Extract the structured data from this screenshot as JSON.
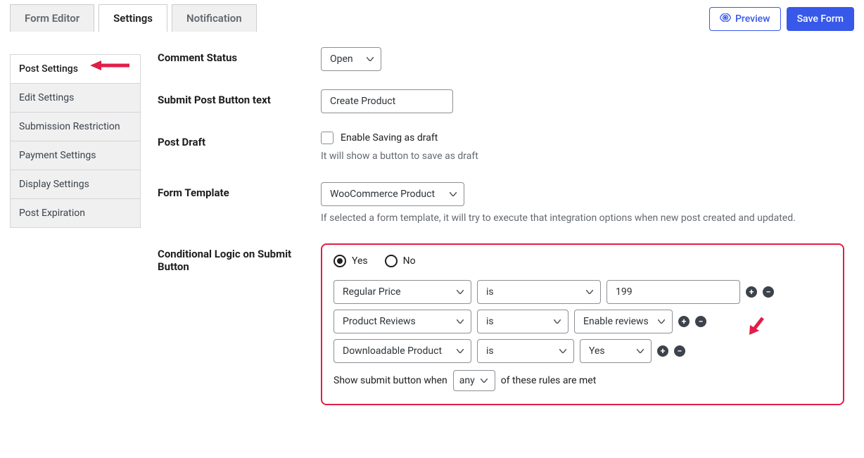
{
  "topTabs": {
    "formEditor": "Form Editor",
    "settings": "Settings",
    "notification": "Notification"
  },
  "actions": {
    "preview": "Preview",
    "saveForm": "Save Form"
  },
  "sidebar": {
    "items": [
      "Post Settings",
      "Edit Settings",
      "Submission Restriction",
      "Payment Settings",
      "Display Settings",
      "Post Expiration"
    ]
  },
  "fields": {
    "commentStatus": {
      "label": "Comment Status",
      "value": "Open"
    },
    "submitButtonText": {
      "label": "Submit Post Button text",
      "value": "Create Product"
    },
    "postDraft": {
      "label": "Post Draft",
      "checkboxLabel": "Enable Saving as draft",
      "help": "It will show a button to save as draft"
    },
    "formTemplate": {
      "label": "Form Template",
      "value": "WooCommerce Product",
      "help": "If selected a form template, it will try to execute that integration options when new post created and updated."
    },
    "conditionalLogic": {
      "label": "Conditional Logic on Submit Button",
      "yes": "Yes",
      "no": "No",
      "rules": [
        {
          "field": "Regular Price",
          "operator": "is",
          "value": "199",
          "valueType": "text"
        },
        {
          "field": "Product Reviews",
          "operator": "is",
          "value": "Enable reviews",
          "valueType": "select"
        },
        {
          "field": "Downloadable Product",
          "operator": "is",
          "value": "Yes",
          "valueType": "select"
        }
      ],
      "matchPrefix": "Show submit button when",
      "matchMode": "any",
      "matchSuffix": "of these rules are met"
    }
  }
}
